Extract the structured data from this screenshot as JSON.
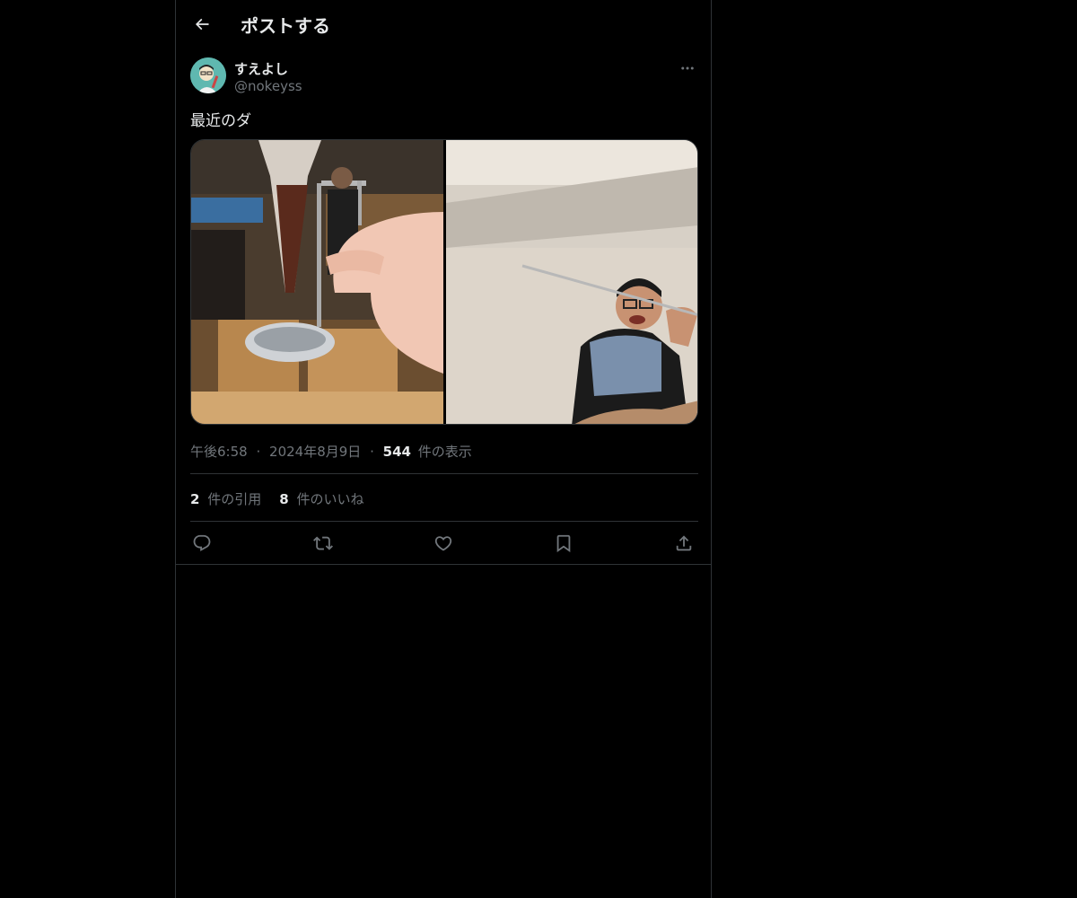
{
  "header": {
    "title": "ポストする"
  },
  "author": {
    "display_name": "すえよし",
    "handle": "@nokeyss"
  },
  "post": {
    "text": "最近のダ",
    "time": "午後6:58",
    "separator": "·",
    "date": "2024年8月9日",
    "views_count": "544",
    "views_label": "件の表示"
  },
  "stats": {
    "quotes_count": "2",
    "quotes_label": "件の引用",
    "likes_count": "8",
    "likes_label": "件のいいね"
  },
  "icons": {
    "back": "arrow-left-icon",
    "more": "more-horizontal-icon",
    "reply": "reply-icon",
    "repost": "repost-icon",
    "like": "heart-icon",
    "bookmark": "bookmark-icon",
    "share": "share-icon"
  },
  "colors": {
    "background": "#000000",
    "text": "#e7e9ea",
    "secondary": "#71767b",
    "border": "#2f3336"
  }
}
